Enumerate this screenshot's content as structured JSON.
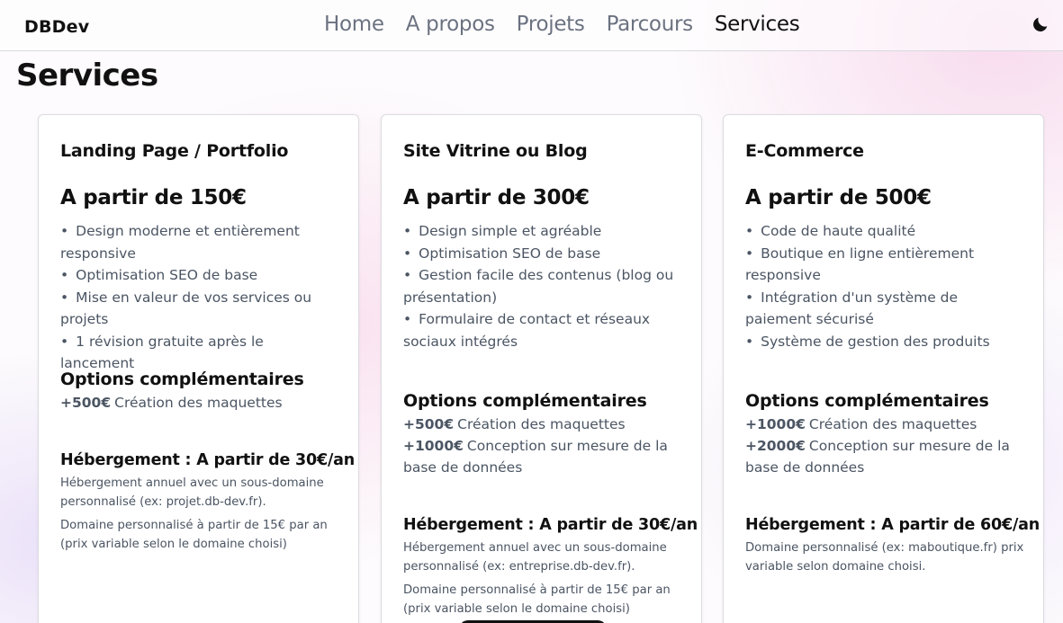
{
  "brand": "DBDev",
  "nav": [
    {
      "label": "Home",
      "active": false
    },
    {
      "label": "A propos",
      "active": false
    },
    {
      "label": "Projets",
      "active": false
    },
    {
      "label": "Parcours",
      "active": false
    },
    {
      "label": "Services",
      "active": true
    }
  ],
  "theme_toggle_icon": "moon-icon",
  "page_title": "Services",
  "cards": [
    {
      "title": "Landing Page / Portfolio",
      "price": "A partir de 150€",
      "features": [
        "Design moderne et entièrement responsive",
        "Optimisation SEO de base",
        "Mise en valeur de vos services ou projets",
        "1 révision gratuite après le lancement"
      ],
      "options_title": "Options complémentaires",
      "options": [
        {
          "price": "+500€",
          "label": "Création des maquettes"
        }
      ],
      "hosting_title": "Hébergement : A partir de 30€/an",
      "hosting_texts": [
        "Hébergement annuel avec un sous-domaine personnalisé (ex: projet.db-dev.fr).",
        "Domaine personnalisé à partir de 15€ par an (prix variable selon le domaine choisi)"
      ]
    },
    {
      "title": "Site Vitrine ou Blog",
      "price": "A partir de 300€",
      "features": [
        "Design simple et agréable",
        "Optimisation SEO de base",
        "Gestion facile des contenus (blog ou présentation)",
        "Formulaire de contact et réseaux sociaux intégrés"
      ],
      "options_title": "Options complémentaires",
      "options": [
        {
          "price": "+500€",
          "label": "Création des maquettes"
        },
        {
          "price": "+1000€",
          "label": "Conception sur mesure de la base de données"
        }
      ],
      "hosting_title": "Hébergement : A partir de 30€/an",
      "hosting_texts": [
        "Hébergement annuel avec un sous-domaine personnalisé (ex: entreprise.db-dev.fr).",
        "Domaine personnalisé à partir de 15€ par an (prix variable selon le domaine choisi)"
      ]
    },
    {
      "title": "E-Commerce",
      "price": "A partir de 500€",
      "features": [
        "Code de haute qualité",
        "Boutique en ligne entièrement responsive",
        "Intégration d'un système de paiement sécurisé",
        "Système de gestion des produits"
      ],
      "options_title": "Options complémentaires",
      "options": [
        {
          "price": "+1000€",
          "label": "Création des maquettes"
        },
        {
          "price": "+2000€",
          "label": "Conception sur mesure de la base de données"
        }
      ],
      "hosting_title": "Hébergement : A partir de 60€/an",
      "hosting_texts": [
        "Domaine personnalisé (ex: maboutique.fr) prix variable selon domaine choisi."
      ]
    }
  ]
}
